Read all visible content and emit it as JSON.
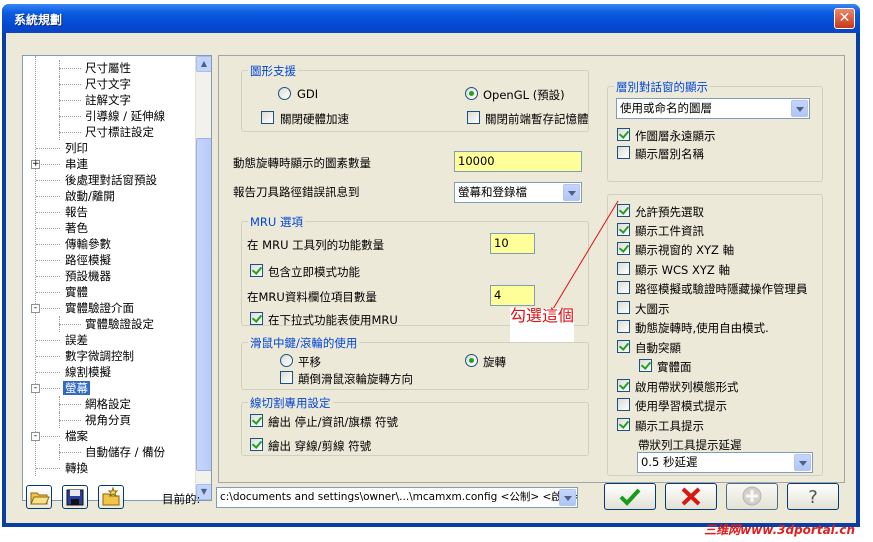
{
  "window": {
    "title": "系統規劃",
    "close_symbol": "✕"
  },
  "tree": {
    "items": [
      {
        "label": "尺寸屬性",
        "level": 2
      },
      {
        "label": "尺寸文字",
        "level": 2
      },
      {
        "label": "註解文字",
        "level": 2
      },
      {
        "label": "引導線 / 延伸線",
        "level": 2
      },
      {
        "label": "尺寸標註設定",
        "level": 2
      },
      {
        "label": "列印",
        "level": 1
      },
      {
        "label": "串連",
        "level": 1,
        "expander": "+"
      },
      {
        "label": "後處理對話窗預設",
        "level": 1
      },
      {
        "label": "啟動/離開",
        "level": 1
      },
      {
        "label": "報告",
        "level": 1
      },
      {
        "label": "著色",
        "level": 1
      },
      {
        "label": "傳輸參數",
        "level": 1
      },
      {
        "label": "路徑模擬",
        "level": 1
      },
      {
        "label": "預設機器",
        "level": 1
      },
      {
        "label": "實體",
        "level": 1
      },
      {
        "label": "實體驗證介面",
        "level": 1,
        "expander": "−"
      },
      {
        "label": "實體驗證設定",
        "level": 2
      },
      {
        "label": "誤差",
        "level": 1
      },
      {
        "label": "數字微調控制",
        "level": 1
      },
      {
        "label": "線割模擬",
        "level": 1
      },
      {
        "label": "螢幕",
        "level": 1,
        "expander": "−",
        "selected": true
      },
      {
        "label": "網格設定",
        "level": 2
      },
      {
        "label": "視角分頁",
        "level": 2
      },
      {
        "label": "檔案",
        "level": 1,
        "expander": "−"
      },
      {
        "label": "自動儲存 / 備份",
        "level": 2
      },
      {
        "label": "轉換",
        "level": 1
      }
    ]
  },
  "graphics": {
    "title": "圖形支援",
    "gdi_label": "GDI",
    "opengl_label": "OpenGL (預設)",
    "disable_hw_accel": "關閉硬體加速",
    "disable_front_buffer": "關閉前端暫存記憶體"
  },
  "dynamic_rotation": {
    "label": "動態旋轉時顯示的圖素數量",
    "value": "10000"
  },
  "toolpath_report": {
    "label": "報告刀具路徑錯誤訊息到",
    "value": "螢幕和登錄檔"
  },
  "mru": {
    "title": "MRU 選項",
    "count_label": "在 MRU 工具列的功能數量",
    "count_value": "10",
    "include_immediate": "包含立即模式功能",
    "bar_items_label": "在MRU資料欄位項目數量",
    "bar_items_value": "4",
    "dropdown_use": "在下拉式功能表使用MRU"
  },
  "mouse": {
    "title": "滑鼠中鍵/滾輪的使用",
    "pan_label": "平移",
    "rotate_label": "旋轉",
    "reverse_label": "顛倒滑鼠滾輪旋轉方向"
  },
  "wirecut": {
    "title": "線切割專用設定",
    "stop_opt": "繪出 停止/資訊/旗標 符號",
    "thread_opt": "繪出 穿線/剪線 符號"
  },
  "layer_dialog": {
    "title": "層別對話窗的顯示",
    "combo_value": "使用或命名的圖層",
    "permanent_main": "作圖層永遠顯示",
    "show_names": "顯示層別名稱"
  },
  "options": [
    {
      "label": "允許預先選取",
      "checked": true
    },
    {
      "label": "顯示工件資訊",
      "checked": true
    },
    {
      "label": "顯示視窗的 XYZ 軸",
      "checked": true
    },
    {
      "label": "顯示 WCS XYZ 軸",
      "checked": false
    },
    {
      "label": "路徑模擬或驗證時隱藏操作管理員",
      "checked": false
    },
    {
      "label": "大圖示",
      "checked": false
    },
    {
      "label": "動態旋轉時,使用自由模式.",
      "checked": false
    },
    {
      "label": "自動突顯",
      "checked": true
    },
    {
      "label": "實體面",
      "checked": true
    },
    {
      "label": "啟用帶狀列模態形式",
      "checked": true
    },
    {
      "label": "使用學習模式提示",
      "checked": false
    },
    {
      "label": "顯示工具提示",
      "checked": true
    }
  ],
  "tooltip_delay": {
    "label": "帶狀列工具提示延遲",
    "value": "0.5 秒延遲"
  },
  "bottom": {
    "current_label": "目前的:",
    "current_value": "c:\\documents and settings\\owner\\...\\mcamxm.config <公制> <啟動>"
  },
  "annotation": {
    "text": "勾選這個"
  },
  "watermark": {
    "text": "三维网www.3dportal.cn"
  },
  "colors": {
    "accent": "#0046d5",
    "highlight_input": "#ffff99",
    "selection": "#316ac5",
    "title_bar": "#0548d2"
  }
}
